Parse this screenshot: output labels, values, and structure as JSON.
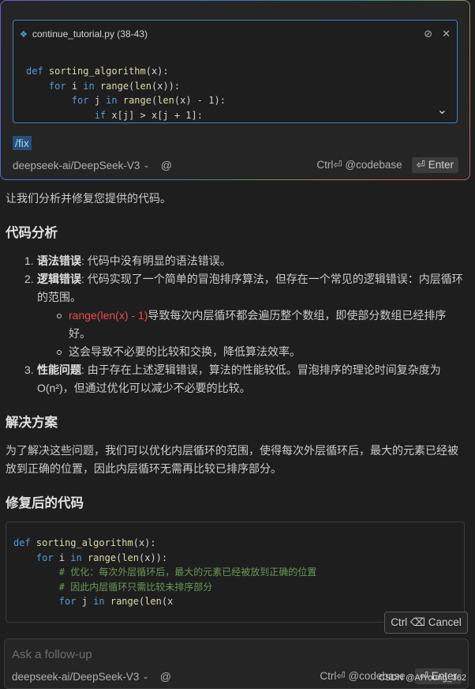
{
  "context": {
    "file_label": "continue_tutorial.py (38-43)",
    "code_lines": [
      {
        "indent": "",
        "parts": [
          {
            "t": "def ",
            "c": "kw"
          },
          {
            "t": "sorting_algorithm",
            "c": "fn"
          },
          {
            "t": "(x):",
            "c": ""
          }
        ]
      },
      {
        "indent": "    ",
        "parts": [
          {
            "t": "for ",
            "c": "kw"
          },
          {
            "t": "i ",
            "c": ""
          },
          {
            "t": "in ",
            "c": "kw"
          },
          {
            "t": "range",
            "c": "fn"
          },
          {
            "t": "(",
            "c": ""
          },
          {
            "t": "len",
            "c": "fn"
          },
          {
            "t": "(x)):",
            "c": ""
          }
        ]
      },
      {
        "indent": "        ",
        "parts": [
          {
            "t": "for ",
            "c": "kw"
          },
          {
            "t": "j ",
            "c": ""
          },
          {
            "t": "in ",
            "c": "kw"
          },
          {
            "t": "range",
            "c": "fn"
          },
          {
            "t": "(",
            "c": ""
          },
          {
            "t": "len",
            "c": "fn"
          },
          {
            "t": "(x) - 1):",
            "c": ""
          }
        ]
      },
      {
        "indent": "            ",
        "parts": [
          {
            "t": "if ",
            "c": "kw"
          },
          {
            "t": "x[j] > x[j + 1]:",
            "c": ""
          }
        ]
      }
    ]
  },
  "input": {
    "slash_command": "/fix"
  },
  "model_bar": {
    "model": "deepseek-ai/DeepSeek-V3",
    "shortcut": "Ctrl⏎ @codebase",
    "enter_label": "⏎ Enter"
  },
  "response": {
    "intro": "让我们分析并修复您提供的代码。",
    "h_analysis": "代码分析",
    "items": [
      {
        "num": "1.",
        "title": "语法错误",
        "text": ": 代码中没有明显的语法错误。"
      },
      {
        "num": "2.",
        "title": "逻辑错误",
        "text": ": 代码实现了一个简单的冒泡排序算法，但存在一个常见的逻辑错误：内层循环的范围。"
      },
      {
        "num": "3.",
        "title": "性能问题",
        "text": ": 由于存在上述逻辑错误，算法的性能较低。冒泡排序的理论时间复杂度为O(n²)，但通过优化可以减少不必要的比较。"
      }
    ],
    "sub1_code": "range(len(x) - 1)",
    "sub1_text": "导致每次内层循环都会遍历整个数组，即使部分数组已经排序好。",
    "sub2_text": "这会导致不必要的比较和交换，降低算法效率。",
    "h_solution": "解决方案",
    "solution_text": "为了解决这些问题，我们可以优化内层循环的范围，使得每次外层循环后，最大的元素已经被放到正确的位置，因此内层循环无需再比较已排序部分。",
    "h_fixed": "修复后的代码"
  },
  "fixed_code_lines": [
    {
      "indent": "",
      "parts": [
        {
          "t": "def ",
          "c": "kw"
        },
        {
          "t": "sorting_algorithm",
          "c": "fn"
        },
        {
          "t": "(x):",
          "c": ""
        }
      ]
    },
    {
      "indent": "    ",
      "parts": [
        {
          "t": "for ",
          "c": "kw"
        },
        {
          "t": "i ",
          "c": ""
        },
        {
          "t": "in ",
          "c": "kw"
        },
        {
          "t": "range",
          "c": "fn"
        },
        {
          "t": "(",
          "c": ""
        },
        {
          "t": "len",
          "c": "fn"
        },
        {
          "t": "(x)):",
          "c": ""
        }
      ]
    },
    {
      "indent": "        ",
      "parts": [
        {
          "t": "# 优化：每次外层循环后，最大的元素已经被放到正确的位置",
          "c": "cm"
        }
      ]
    },
    {
      "indent": "        ",
      "parts": [
        {
          "t": "# 因此内层循环只需比较未排序部分",
          "c": "cm"
        }
      ]
    },
    {
      "indent": "        ",
      "parts": [
        {
          "t": "for ",
          "c": "kw"
        },
        {
          "t": "j ",
          "c": ""
        },
        {
          "t": "in ",
          "c": "kw"
        },
        {
          "t": "range",
          "c": "fn"
        },
        {
          "t": "(",
          "c": ""
        },
        {
          "t": "len",
          "c": "fn"
        },
        {
          "t": "(x",
          "c": ""
        }
      ]
    }
  ],
  "cancel_label": "Ctrl ⌫ Cancel",
  "followup": {
    "placeholder": "Ask a follow-up"
  },
  "watermark": "CSDN @AIYoung_362"
}
